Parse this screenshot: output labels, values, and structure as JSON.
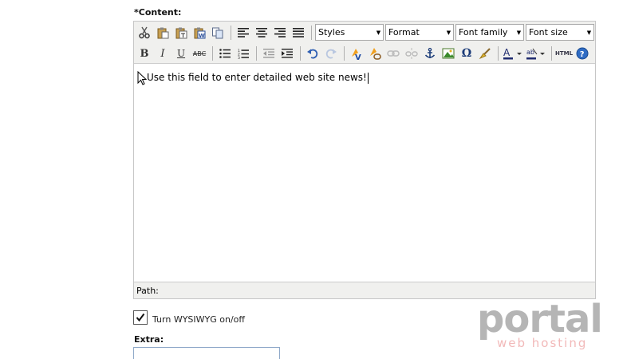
{
  "content_label": "*Content:",
  "toolbar": {
    "styles_select": "Styles",
    "format_select": "Format",
    "font_family_select": "Font family",
    "font_size_select": "Font size",
    "bold_label": "B",
    "italic_label": "I",
    "underline_label": "U",
    "strikethrough_label": "ABC",
    "special_char_label": "Ω",
    "html_label": "HTML",
    "help_label": "?"
  },
  "editor": {
    "body_text": "Use this field to enter detailed web site news!",
    "path_label": "Path:"
  },
  "wysiwyg_toggle": {
    "label": "Turn WYSIWYG on/off",
    "checked": true
  },
  "extra_label": "Extra:",
  "logo": {
    "name": "portal",
    "tagline": "web hosting"
  },
  "colors": {
    "toolbar_bg": "#f0f0ee",
    "border": "#c6c6c6",
    "logo_gray": "#a9a9a9",
    "logo_pink": "#f2b9b9"
  }
}
